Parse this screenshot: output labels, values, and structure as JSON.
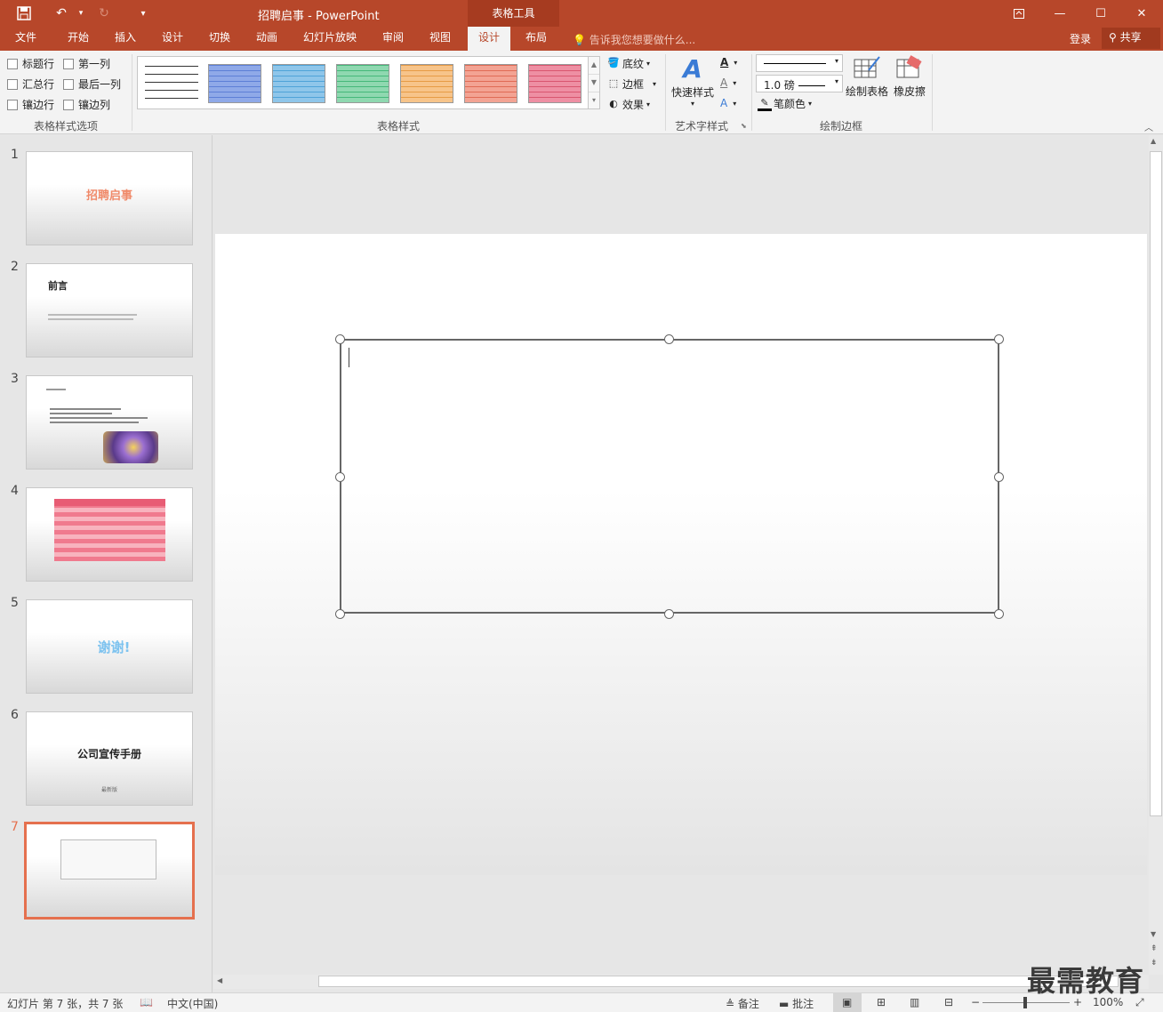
{
  "titlebar": {
    "title": "招聘启事 - PowerPoint",
    "context_tab": "表格工具"
  },
  "tabs": [
    "文件",
    "开始",
    "插入",
    "设计",
    "切换",
    "动画",
    "幻灯片放映",
    "审阅",
    "视图",
    "设计",
    "布局"
  ],
  "tellme": "告诉我您想要做什么...",
  "account": {
    "login": "登录",
    "share": "共享"
  },
  "options": {
    "header_row": "标题行",
    "first_column": "第一列",
    "total_row": "汇总行",
    "last_column": "最后一列",
    "banded_rows": "镶边行",
    "banded_columns": "镶边列",
    "group": "表格样式选项"
  },
  "styles": {
    "group": "表格样式",
    "shading": "底纹",
    "borders": "边框",
    "effects": "效果",
    "swatch_colors": [
      "#ffffff",
      "#8fa9e8",
      "#8fc6ea",
      "#8fd8b0",
      "#f7c48a",
      "#f3a393",
      "#ee8fa3"
    ]
  },
  "wordart": {
    "quick_styles": "快速样式",
    "group": "艺术字样式"
  },
  "draw_borders": {
    "pen_weight": "1.0 磅",
    "pen_color": "笔颜色",
    "draw_table": "绘制表格",
    "eraser": "橡皮擦",
    "group": "绘制边框"
  },
  "thumbnails": [
    {
      "num": "1",
      "text": "招聘启事"
    },
    {
      "num": "2",
      "text": "前言"
    },
    {
      "num": "3",
      "text": ""
    },
    {
      "num": "4",
      "text": ""
    },
    {
      "num": "5",
      "text": "谢谢!"
    },
    {
      "num": "6",
      "text": "公司宣传手册",
      "sub": "最新版"
    },
    {
      "num": "7",
      "text": ""
    }
  ],
  "status": {
    "slide_info": "幻灯片 第 7 张，共 7 张",
    "language": "中文(中国)",
    "notes": "备注",
    "comments": "批注",
    "zoom": "100%"
  },
  "watermark": "最需教育",
  "colors": {
    "accent": "#b7472a",
    "selected_border": "#e5704e"
  }
}
